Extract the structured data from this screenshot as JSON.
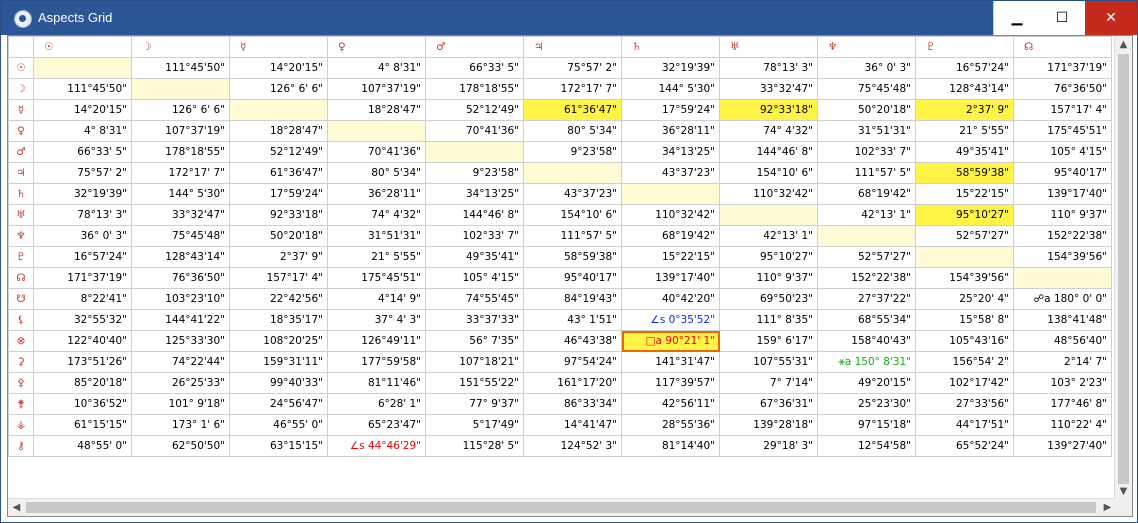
{
  "window": {
    "title": "Aspects Grid",
    "minimize": "▁",
    "maximize": "☐",
    "close": "✕"
  },
  "columns": [
    "☉",
    "☽",
    "☿",
    "♀",
    "♂",
    "♃",
    "♄",
    "♅",
    "♆",
    "♇",
    "☊"
  ],
  "rows": [
    {
      "head": "☉",
      "cells": [
        "",
        "111°45'50\"",
        "14°20'15\"",
        "4° 8'31\"",
        "66°33' 5\"",
        "75°57' 2\"",
        "32°19'39\"",
        "78°13' 3\"",
        "36° 0' 3\"",
        "16°57'24\"",
        "171°37'19\""
      ]
    },
    {
      "head": "☽",
      "cells": [
        "111°45'50\"",
        "",
        "126° 6' 6\"",
        "107°37'19\"",
        "178°18'55\"",
        "172°17' 7\"",
        "144° 5'30\"",
        "33°32'47\"",
        "75°45'48\"",
        "128°43'14\"",
        "76°36'50\""
      ]
    },
    {
      "head": "☿",
      "cells": [
        "14°20'15\"",
        "126° 6' 6\"",
        "",
        "18°28'47\"",
        "52°12'49\"",
        "61°36'47\"",
        "17°59'24\"",
        "92°33'18\"",
        "50°20'18\"",
        "2°37' 9\"",
        "157°17' 4\""
      ]
    },
    {
      "head": "♀",
      "cells": [
        "4° 8'31\"",
        "107°37'19\"",
        "18°28'47\"",
        "",
        "70°41'36\"",
        "80° 5'34\"",
        "36°28'11\"",
        "74° 4'32\"",
        "31°51'31\"",
        "21° 5'55\"",
        "175°45'51\""
      ]
    },
    {
      "head": "♂",
      "cells": [
        "66°33' 5\"",
        "178°18'55\"",
        "52°12'49\"",
        "70°41'36\"",
        "",
        "9°23'58\"",
        "34°13'25\"",
        "144°46' 8\"",
        "102°33' 7\"",
        "49°35'41\"",
        "105° 4'15\""
      ]
    },
    {
      "head": "♃",
      "cells": [
        "75°57' 2\"",
        "172°17' 7\"",
        "61°36'47\"",
        "80° 5'34\"",
        "9°23'58\"",
        "",
        "43°37'23\"",
        "154°10' 6\"",
        "111°57' 5\"",
        "58°59'38\"",
        "95°40'17\""
      ]
    },
    {
      "head": "♄",
      "cells": [
        "32°19'39\"",
        "144° 5'30\"",
        "17°59'24\"",
        "36°28'11\"",
        "34°13'25\"",
        "43°37'23\"",
        "",
        "110°32'42\"",
        "68°19'42\"",
        "15°22'15\"",
        "139°17'40\""
      ]
    },
    {
      "head": "♅",
      "cells": [
        "78°13' 3\"",
        "33°32'47\"",
        "92°33'18\"",
        "74° 4'32\"",
        "144°46' 8\"",
        "154°10' 6\"",
        "110°32'42\"",
        "",
        "42°13' 1\"",
        "95°10'27\"",
        "110° 9'37\""
      ]
    },
    {
      "head": "♆",
      "cells": [
        "36° 0' 3\"",
        "75°45'48\"",
        "50°20'18\"",
        "31°51'31\"",
        "102°33' 7\"",
        "111°57' 5\"",
        "68°19'42\"",
        "42°13' 1\"",
        "",
        "52°57'27\"",
        "152°22'38\""
      ]
    },
    {
      "head": "♇",
      "cells": [
        "16°57'24\"",
        "128°43'14\"",
        "2°37' 9\"",
        "21° 5'55\"",
        "49°35'41\"",
        "58°59'38\"",
        "15°22'15\"",
        "95°10'27\"",
        "52°57'27\"",
        "",
        "154°39'56\""
      ]
    },
    {
      "head": "☊",
      "cells": [
        "171°37'19\"",
        "76°36'50\"",
        "157°17' 4\"",
        "175°45'51\"",
        "105° 4'15\"",
        "95°40'17\"",
        "139°17'40\"",
        "110° 9'37\"",
        "152°22'38\"",
        "154°39'56\"",
        ""
      ]
    },
    {
      "head": "☋",
      "cells": [
        "8°22'41\"",
        "103°23'10\"",
        "22°42'56\"",
        "4°14' 9\"",
        "74°55'45\"",
        "84°19'43\"",
        "40°42'20\"",
        "69°50'23\"",
        "27°37'22\"",
        "25°20' 4\"",
        "☍a 180° 0' 0\""
      ]
    },
    {
      "head": "⚸",
      "cells": [
        "32°55'32\"",
        "144°41'22\"",
        "18°35'17\"",
        "37° 4' 3\"",
        "33°37'33\"",
        "43° 1'51\"",
        "∠s  0°35'52\"",
        "111° 8'35\"",
        "68°55'34\"",
        "15°58' 8\"",
        "138°41'48\""
      ]
    },
    {
      "head": "⊗",
      "cells": [
        "122°40'40\"",
        "125°33'30\"",
        "108°20'25\"",
        "126°49'11\"",
        "56° 7'35\"",
        "46°43'38\"",
        "□a  90°21' 1\"",
        "159° 6'17\"",
        "158°40'43\"",
        "105°43'16\"",
        "48°56'40\""
      ]
    },
    {
      "head": "⚳",
      "cells": [
        "173°51'26\"",
        "74°22'44\"",
        "159°31'11\"",
        "177°59'58\"",
        "107°18'21\"",
        "97°54'24\"",
        "141°31'47\"",
        "107°55'31\"",
        "⚹a 150° 8'31\"",
        "156°54' 2\"",
        "2°14' 7\""
      ]
    },
    {
      "head": "⚴",
      "cells": [
        "85°20'18\"",
        "26°25'33\"",
        "99°40'33\"",
        "81°11'46\"",
        "151°55'22\"",
        "161°17'20\"",
        "117°39'57\"",
        "7° 7'14\"",
        "49°20'15\"",
        "102°17'42\"",
        "103° 2'23\""
      ]
    },
    {
      "head": "⚵",
      "cells": [
        "10°36'52\"",
        "101° 9'18\"",
        "24°56'47\"",
        "6°28' 1\"",
        "77° 9'37\"",
        "86°33'34\"",
        "42°56'11\"",
        "67°36'31\"",
        "25°23'30\"",
        "27°33'56\"",
        "177°46' 8\""
      ]
    },
    {
      "head": "⚶",
      "cells": [
        "61°15'15\"",
        "173° 1' 6\"",
        "46°55' 0\"",
        "65°23'47\"",
        "5°17'49\"",
        "14°41'47\"",
        "28°55'36\"",
        "139°28'18\"",
        "97°15'18\"",
        "44°17'51\"",
        "110°22' 4\""
      ]
    },
    {
      "head": "⚷",
      "cells": [
        "48°55' 0\"",
        "62°50'50\"",
        "63°15'15\"",
        "∠s  44°46'29\"",
        "115°28' 5\"",
        "124°52' 3\"",
        "81°14'40\"",
        "29°18' 3\"",
        "12°54'58\"",
        "65°52'24\"",
        "139°27'40\""
      ]
    }
  ],
  "highlights": {
    "diag": [
      [
        0,
        0
      ],
      [
        1,
        1
      ],
      [
        2,
        2
      ],
      [
        3,
        3
      ],
      [
        4,
        4
      ],
      [
        5,
        5
      ],
      [
        6,
        6
      ],
      [
        7,
        7
      ],
      [
        8,
        8
      ],
      [
        9,
        9
      ],
      [
        10,
        10
      ]
    ],
    "yellow": [
      [
        2,
        5
      ],
      [
        2,
        7
      ],
      [
        2,
        9
      ],
      [
        5,
        9
      ],
      [
        7,
        9
      ]
    ],
    "outlined": [
      [
        13,
        6
      ]
    ],
    "red": [
      [
        18,
        3
      ]
    ],
    "blue": [
      [
        12,
        6
      ]
    ],
    "green": [
      [
        14,
        8
      ]
    ]
  },
  "scroll": {
    "up": "▲",
    "down": "▼",
    "left": "◀",
    "right": "▶"
  },
  "colors": {
    "titlebar": "#2b5797",
    "symbol": "#c0392b",
    "highlight": "#fff345",
    "diag": "#fff9d4"
  }
}
